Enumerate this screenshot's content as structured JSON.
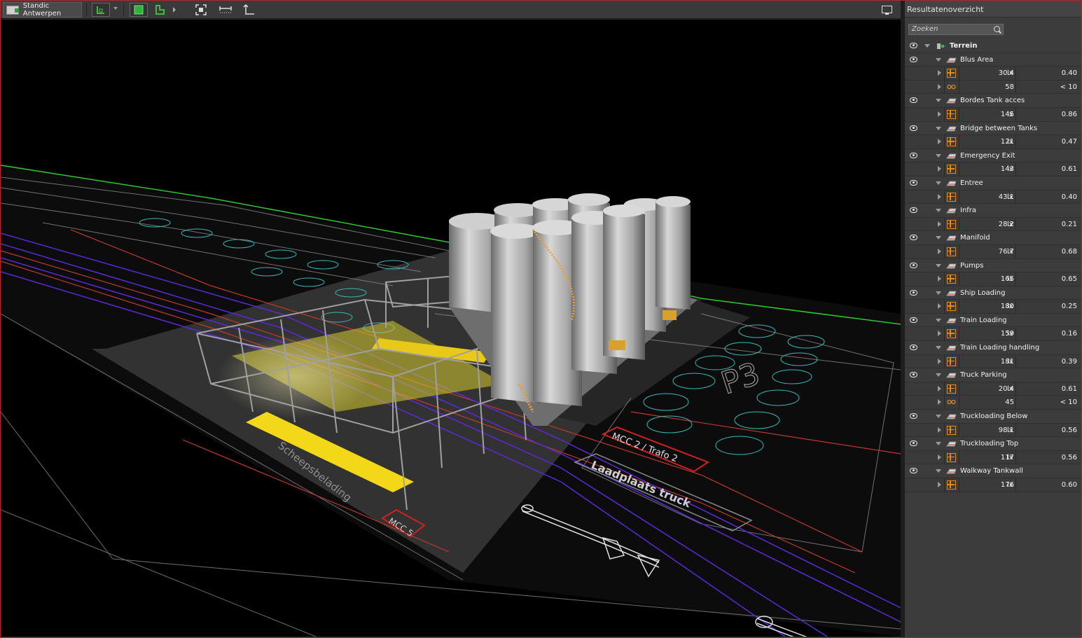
{
  "toolbar": {
    "project_label": "Standic Antwerpen",
    "icons": [
      "project-icon",
      "view-mode-icon",
      "dropdown-icon",
      "shaded-view-icon",
      "wire-view-icon",
      "expand-icon",
      "fit-view-icon",
      "measure-distance-icon",
      "measure-height-icon",
      "monitor-icon"
    ]
  },
  "panel": {
    "title": "Resultatenoverzicht",
    "search_placeholder": "Zoeken",
    "root": "Terrein",
    "areas": [
      {
        "name": "Blus Area",
        "results": [
          {
            "kind": "illuminance",
            "value": "30.4",
            "unit": "lx",
            "ratio": "0.40"
          },
          {
            "kind": "glare",
            "value": "58",
            "unit": "",
            "ratio": "< 10"
          }
        ]
      },
      {
        "name": "Bordes Tank acces",
        "results": [
          {
            "kind": "illuminance",
            "value": "145",
            "unit": "lx",
            "ratio": "0.86"
          }
        ]
      },
      {
        "name": "Bridge between Tanks",
        "results": [
          {
            "kind": "illuminance",
            "value": "121",
            "unit": "lx",
            "ratio": "0.47"
          }
        ]
      },
      {
        "name": "Emergency Exit",
        "results": [
          {
            "kind": "illuminance",
            "value": "143",
            "unit": "lx",
            "ratio": "0.61"
          }
        ]
      },
      {
        "name": "Entree",
        "results": [
          {
            "kind": "illuminance",
            "value": "43.1",
            "unit": "lx",
            "ratio": "0.40"
          }
        ]
      },
      {
        "name": "Infra",
        "results": [
          {
            "kind": "illuminance",
            "value": "28.2",
            "unit": "lx",
            "ratio": "0.21"
          }
        ]
      },
      {
        "name": "Manifold",
        "results": [
          {
            "kind": "illuminance",
            "value": "76.7",
            "unit": "lx",
            "ratio": "0.68"
          }
        ]
      },
      {
        "name": "Pumps",
        "results": [
          {
            "kind": "illuminance",
            "value": "165",
            "unit": "lx",
            "ratio": "0.65"
          }
        ]
      },
      {
        "name": "Ship Loading",
        "results": [
          {
            "kind": "illuminance",
            "value": "180",
            "unit": "lx",
            "ratio": "0.25"
          }
        ]
      },
      {
        "name": "Train Loading",
        "results": [
          {
            "kind": "illuminance",
            "value": "159",
            "unit": "lx",
            "ratio": "0.16"
          }
        ]
      },
      {
        "name": "Train Loading handling",
        "results": [
          {
            "kind": "illuminance",
            "value": "181",
            "unit": "lx",
            "ratio": "0.39"
          }
        ]
      },
      {
        "name": "Truck Parking",
        "results": [
          {
            "kind": "illuminance",
            "value": "20.4",
            "unit": "lx",
            "ratio": "0.61"
          },
          {
            "kind": "glare",
            "value": "45",
            "unit": "",
            "ratio": "< 10"
          }
        ]
      },
      {
        "name": "Truckloading Below",
        "results": [
          {
            "kind": "illuminance",
            "value": "98.1",
            "unit": "lx",
            "ratio": "0.56"
          }
        ]
      },
      {
        "name": "Truckloading Top",
        "results": [
          {
            "kind": "illuminance",
            "value": "117",
            "unit": "lx",
            "ratio": "0.56"
          }
        ]
      },
      {
        "name": "Walkway Tankwall",
        "results": [
          {
            "kind": "illuminance",
            "value": "176",
            "unit": "lx",
            "ratio": "0.60"
          }
        ]
      }
    ]
  },
  "scene": {
    "labels": [
      "MCC 2 / Trafo 2",
      "Laadplaats truck",
      "MCC 5",
      "Scheepsbelading",
      "P3"
    ],
    "colors": {
      "background": "#000000",
      "boundary": "#2ec82e",
      "road": "#c0392b",
      "rail": "#5a2ad8",
      "tank": "#b8b8b8",
      "lit_area": "#e8d81a",
      "tank_outline": "#38b8b8"
    }
  }
}
